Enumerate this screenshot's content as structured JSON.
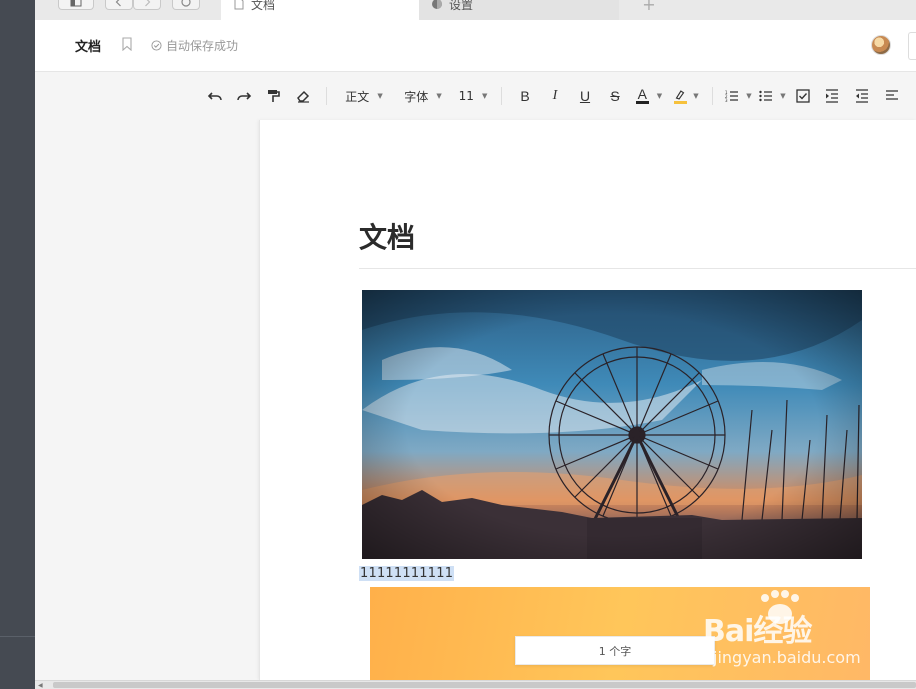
{
  "tabs": [
    {
      "label": "文档",
      "active": true
    },
    {
      "label": "设置",
      "active": false
    }
  ],
  "header": {
    "doc_name": "文档",
    "save_status": "自动保存成功"
  },
  "toolbar": {
    "paragraph_style": "正文",
    "font_family": "字体",
    "font_size": "11",
    "bold": "B",
    "italic": "I",
    "underline": "U",
    "strike": "S",
    "font_color": "A",
    "font_color_hex": "#222222",
    "highlight_hex": "#f6c13c"
  },
  "document": {
    "title": "文档",
    "typed_text": "11111111111"
  },
  "status": {
    "word_count": "1 个字"
  },
  "watermark": {
    "brand": "Bai经验",
    "url": "jingyan.baidu.com"
  }
}
